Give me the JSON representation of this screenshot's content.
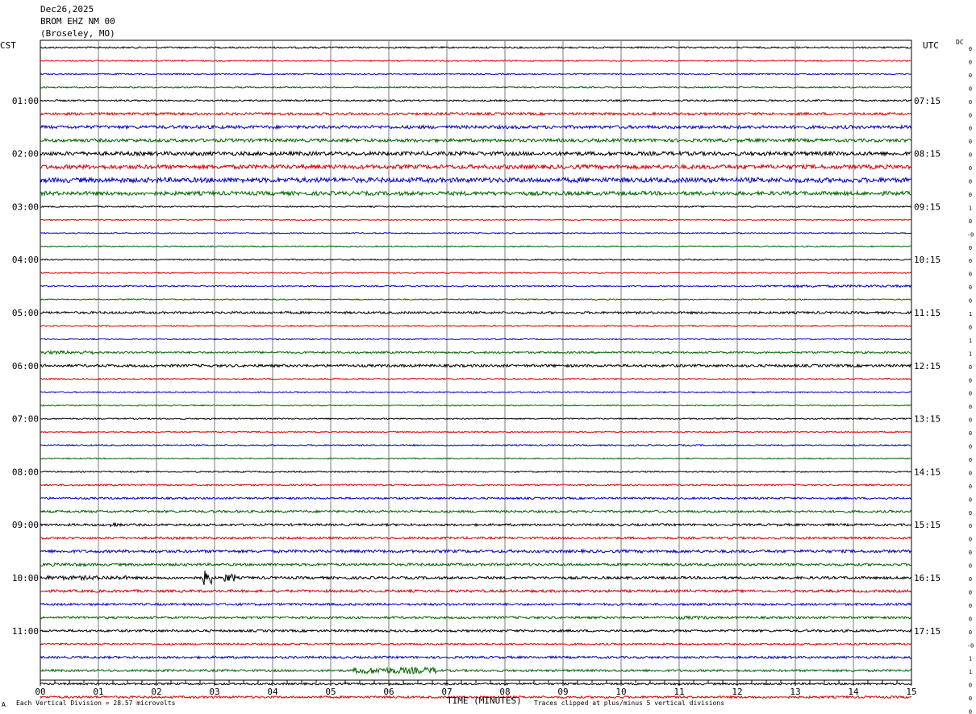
{
  "header": {
    "date": "Dec26,2025",
    "station": "BROM EHZ NM 00",
    "location": "(Broseley, MO)"
  },
  "labels": {
    "left_tz": "CST",
    "right_tz": "UTC",
    "dc": "DC"
  },
  "footer": {
    "scale": "Each Vertical Division =   28.57 microvolts",
    "xlabel": "TIME (MINUTES)",
    "clip": "Traces clipped at plus/minus 5 vertical divisions",
    "corner_mark": "A"
  },
  "chart_data": {
    "type": "line",
    "title": "BROM EHZ NM 00",
    "xlabel": "TIME (MINUTES)",
    "x_ticks": [
      "00",
      "01",
      "02",
      "03",
      "04",
      "05",
      "06",
      "07",
      "08",
      "09",
      "10",
      "11",
      "12",
      "13",
      "14",
      "15"
    ],
    "xlim": [
      0,
      15
    ],
    "grid": true,
    "trace_colors": [
      "#000000",
      "#dd0000",
      "#0000cc",
      "#006600"
    ],
    "left_hour_labels": [
      "01:00",
      "02:00",
      "03:00",
      "04:00",
      "05:00",
      "06:00",
      "07:00",
      "08:00",
      "09:00",
      "10:00",
      "11:00"
    ],
    "right_hour_labels": [
      "07:15",
      "08:15",
      "09:15",
      "10:15",
      "11:15",
      "12:15",
      "13:15",
      "14:15",
      "15:15",
      "16:15",
      "17:15"
    ],
    "dc_values": [
      "0",
      "0",
      "0",
      "0",
      "0",
      "0",
      "0",
      "0",
      "0",
      "0",
      "0",
      "0",
      "1",
      "0",
      "-0",
      "0",
      "0",
      "0",
      "0",
      "0",
      "1",
      "0",
      "1",
      "1",
      "0",
      "0",
      "0",
      "0",
      "0",
      "0",
      "0",
      "0",
      "0",
      "0",
      "0",
      "0",
      "0",
      "0",
      "0",
      "0",
      "0",
      "0",
      "0",
      "0",
      "0",
      "-0",
      "1",
      "1",
      "0",
      "0",
      "0"
    ],
    "trace_noise": [
      1.0,
      0.8,
      0.8,
      0.8,
      1.0,
      1.6,
      2.0,
      2.0,
      2.4,
      2.6,
      3.0,
      2.4,
      0.8,
      0.7,
      0.7,
      0.7,
      0.8,
      0.7,
      0.8,
      0.7,
      1.4,
      0.8,
      0.7,
      1.2,
      1.6,
      0.8,
      0.8,
      0.7,
      0.8,
      0.7,
      0.8,
      0.7,
      0.8,
      1.0,
      1.2,
      1.4,
      1.4,
      1.4,
      1.8,
      1.6,
      1.6,
      1.6,
      1.4,
      1.4,
      1.4,
      1.2,
      1.4,
      1.4,
      1.2,
      1.4
    ],
    "events": [
      {
        "trace": 36,
        "minute_start": 1.2,
        "minute_end": 1.4,
        "amplitude": 3
      },
      {
        "trace": 39,
        "minute_start": 0.0,
        "minute_end": 0.8,
        "amplitude": 2
      },
      {
        "trace": 40,
        "minute_start": 0.0,
        "minute_end": 1.5,
        "amplitude": 2.5
      },
      {
        "trace": 40,
        "minute_start": 2.8,
        "minute_end": 2.95,
        "amplitude": 9
      },
      {
        "trace": 40,
        "minute_start": 3.15,
        "minute_end": 3.35,
        "amplitude": 5
      },
      {
        "trace": 43,
        "minute_start": 11.0,
        "minute_end": 11.5,
        "amplitude": 2
      },
      {
        "trace": 47,
        "minute_start": 5.4,
        "minute_end": 6.9,
        "amplitude": 4
      },
      {
        "trace": 23,
        "minute_start": 0.0,
        "minute_end": 1.0,
        "amplitude": 2
      },
      {
        "trace": 20,
        "minute_start": 3.5,
        "minute_end": 4.5,
        "amplitude": 1.5
      },
      {
        "trace": 18,
        "minute_start": 12.5,
        "minute_end": 15.0,
        "amplitude": 1.5
      }
    ]
  }
}
